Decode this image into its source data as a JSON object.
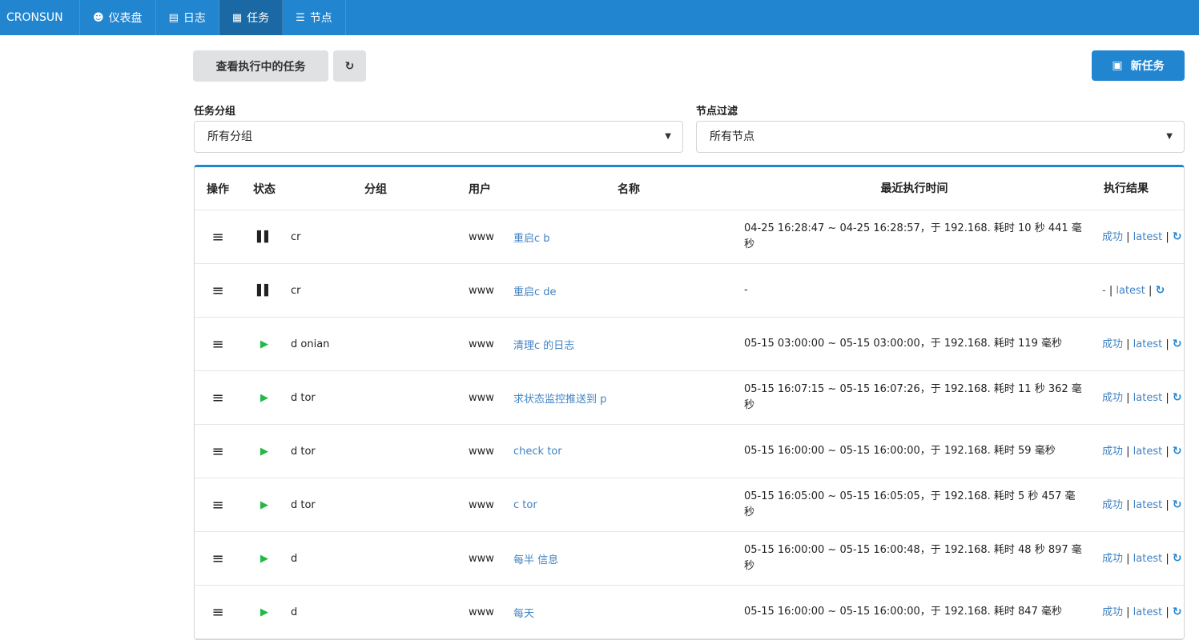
{
  "nav": {
    "brand": "CRONSUN",
    "items": [
      {
        "icon": "dashboard-icon",
        "glyph": "☻",
        "label": "仪表盘"
      },
      {
        "icon": "file-icon",
        "glyph": "▤",
        "label": "日志"
      },
      {
        "icon": "calendar-icon",
        "glyph": "▦",
        "label": "任务"
      },
      {
        "icon": "server-icon",
        "glyph": "☰",
        "label": "节点"
      }
    ]
  },
  "toolbar": {
    "running_tasks_label": "查看执行中的任务",
    "refresh_glyph": "↻",
    "new_task_glyph": "▣",
    "new_task_label": "新任务"
  },
  "filters": {
    "group_label": "任务分组",
    "group_value": "所有分组",
    "node_label": "节点过滤",
    "node_value": "所有节点"
  },
  "table": {
    "headers": {
      "op": "操作",
      "status": "状态",
      "group": "分组",
      "user": "用户",
      "name": "名称",
      "last_exec": "最近执行时间",
      "result": "执行结果"
    },
    "rows": [
      {
        "status": "paused",
        "group": "cr",
        "user": "www",
        "name": "重启c b",
        "time": "04-25 16:28:47 ~ 04-25 16:28:57，于 192.168. 耗时 10 秒 441 毫秒",
        "result": "成功",
        "latest": "latest"
      },
      {
        "status": "paused",
        "group": "cr",
        "user": "www",
        "name": "重启c de",
        "time": "-",
        "result": "-",
        "latest": "latest"
      },
      {
        "status": "running",
        "group": "d onian",
        "user": "www",
        "name": "清理c 的日志",
        "time": "05-15 03:00:00 ~ 05-15 03:00:00，于 192.168. 耗时 119 毫秒",
        "result": "成功",
        "latest": "latest"
      },
      {
        "status": "running",
        "group": "d tor",
        "user": "www",
        "name": "求状态监控推送到 p",
        "time": "05-15 16:07:15 ~ 05-15 16:07:26，于 192.168. 耗时 11 秒 362 毫秒",
        "result": "成功",
        "latest": "latest"
      },
      {
        "status": "running",
        "group": "d tor",
        "user": "www",
        "name": "check tor",
        "time": "05-15 16:00:00 ~ 05-15 16:00:00，于 192.168. 耗时 59 毫秒",
        "result": "成功",
        "latest": "latest"
      },
      {
        "status": "running",
        "group": "d tor",
        "user": "www",
        "name": "c tor",
        "time": "05-15 16:05:00 ~ 05-15 16:05:05，于 192.168. 耗时 5 秒 457 毫秒",
        "result": "成功",
        "latest": "latest"
      },
      {
        "status": "running",
        "group": "d",
        "user": "www",
        "name": "每半 信息",
        "time": "05-15 16:00:00 ~ 05-15 16:00:48，于 192.168. 耗时 48 秒 897 毫秒",
        "result": "成功",
        "latest": "latest"
      },
      {
        "status": "running",
        "group": "d",
        "user": "www",
        "name": "每天",
        "time": "05-15 16:00:00 ~ 05-15 16:00:00，于 192.168. 耗时 847 毫秒",
        "result": "成功",
        "latest": "latest"
      }
    ]
  },
  "colors": {
    "primary": "#2185d0",
    "play": "#21ba45",
    "link": "#4183c4"
  }
}
